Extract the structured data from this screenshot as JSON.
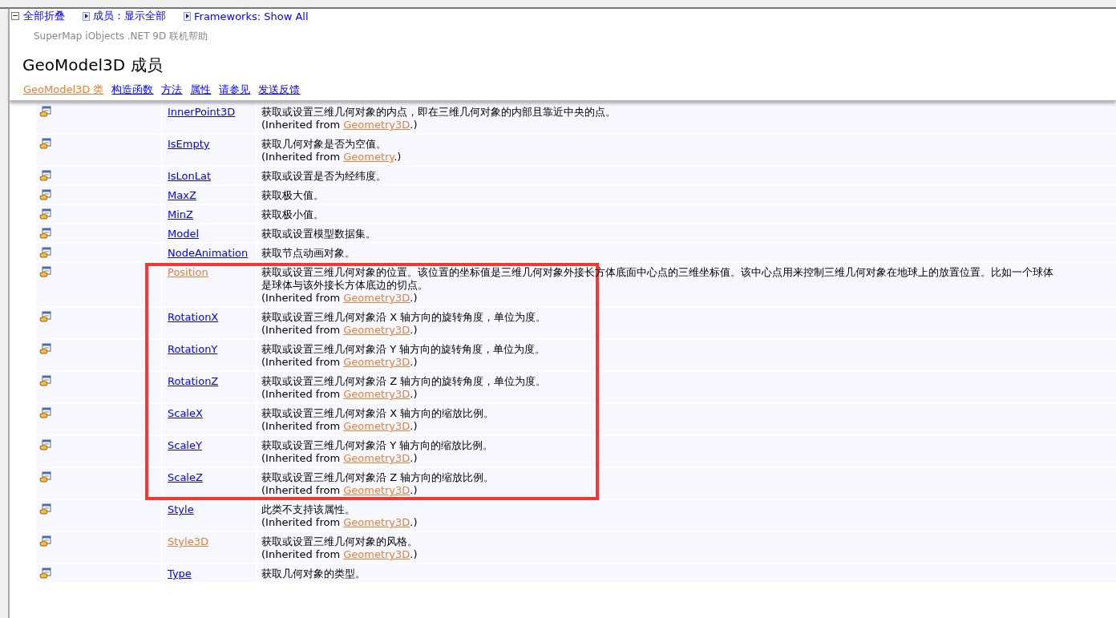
{
  "toolbar": {
    "collapse_all": "全部折叠",
    "members_filter": "成员：显示全部",
    "frameworks_filter": "Frameworks: Show All"
  },
  "header": {
    "subtitle": "SuperMap iObjects .NET 9D 联机帮助",
    "title": "GeoModel3D 成员",
    "nav": [
      {
        "label": "GeoModel3D 类",
        "visited": true
      },
      {
        "label": "构造函数",
        "visited": false
      },
      {
        "label": "方法",
        "visited": false
      },
      {
        "label": "属性",
        "visited": false
      },
      {
        "label": "请参见",
        "visited": false
      },
      {
        "label": "发送反馈",
        "visited": false
      }
    ]
  },
  "members": [
    {
      "name": "InnerPoint3D",
      "visited": false,
      "highlighted": false,
      "lines": [
        "获取或设置三维几何对象的内点，即在三维几何对象的内部且靠近中央的点。"
      ],
      "inherited": {
        "prefix": "(Inherited from ",
        "link": "Geometry3D",
        "suffix": ".)"
      }
    },
    {
      "name": "IsEmpty",
      "visited": false,
      "highlighted": false,
      "lines": [
        "获取几何对象是否为空值。"
      ],
      "inherited": {
        "prefix": "(Inherited from ",
        "link": "Geometry",
        "suffix": ".)"
      }
    },
    {
      "name": "IsLonLat",
      "visited": false,
      "highlighted": false,
      "lines": [
        "获取或设置是否为经纬度。"
      ]
    },
    {
      "name": "MaxZ",
      "visited": false,
      "highlighted": false,
      "lines": [
        "获取极大值。"
      ]
    },
    {
      "name": "MinZ",
      "visited": false,
      "highlighted": false,
      "lines": [
        "获取极小值。"
      ]
    },
    {
      "name": "Model",
      "visited": false,
      "highlighted": false,
      "lines": [
        "获取或设置模型数据集。"
      ]
    },
    {
      "name": "NodeAnimation",
      "visited": false,
      "highlighted": false,
      "lines": [
        "获取节点动画对象。"
      ]
    },
    {
      "name": "Position",
      "visited": true,
      "highlighted": true,
      "lines": [
        "获取或设置三维几何对象的位置。该位置的坐标值是三维几何对象外接长方体底面中心点的三维坐标值。该中心点用来控制三维几何对象在地球上的放置位置。比如一个球体",
        "是球体与该外接长方体底边的切点。"
      ],
      "inherited": {
        "prefix": "(Inherited from ",
        "link": "Geometry3D",
        "suffix": ".)"
      }
    },
    {
      "name": "RotationX",
      "visited": false,
      "highlighted": true,
      "lines": [
        "获取或设置三维几何对象沿 X 轴方向的旋转角度，单位为度。"
      ],
      "inherited": {
        "prefix": "(Inherited from ",
        "link": "Geometry3D",
        "suffix": ".)"
      }
    },
    {
      "name": "RotationY",
      "visited": false,
      "highlighted": true,
      "lines": [
        "获取或设置三维几何对象沿 Y 轴方向的旋转角度，单位为度。"
      ],
      "inherited": {
        "prefix": "(Inherited from ",
        "link": "Geometry3D",
        "suffix": ".)"
      }
    },
    {
      "name": "RotationZ",
      "visited": false,
      "highlighted": true,
      "lines": [
        "获取或设置三维几何对象沿 Z 轴方向的旋转角度，单位为度。"
      ],
      "inherited": {
        "prefix": "(Inherited from ",
        "link": "Geometry3D",
        "suffix": ".)"
      }
    },
    {
      "name": "ScaleX",
      "visited": false,
      "highlighted": true,
      "lines": [
        "获取或设置三维几何对象沿 X 轴方向的缩放比例。"
      ],
      "inherited": {
        "prefix": "(Inherited from ",
        "link": "Geometry3D",
        "suffix": ".)"
      }
    },
    {
      "name": "ScaleY",
      "visited": false,
      "highlighted": true,
      "lines": [
        "获取或设置三维几何对象沿 Y 轴方向的缩放比例。"
      ],
      "inherited": {
        "prefix": "(Inherited from ",
        "link": "Geometry3D",
        "suffix": ".)"
      }
    },
    {
      "name": "ScaleZ",
      "visited": false,
      "highlighted": true,
      "lines": [
        "获取或设置三维几何对象沿 Z 轴方向的缩放比例。"
      ],
      "inherited": {
        "prefix": "(Inherited from ",
        "link": "Geometry3D",
        "suffix": ".)"
      }
    },
    {
      "name": "Style",
      "visited": false,
      "highlighted": false,
      "lines": [
        "此类不支持该属性。"
      ],
      "inherited": {
        "prefix": "(Inherited from ",
        "link": "Geometry3D",
        "suffix": ".)"
      }
    },
    {
      "name": "Style3D",
      "visited": true,
      "highlighted": false,
      "lines": [
        "获取或设置三维几何对象的风格。"
      ],
      "inherited": {
        "prefix": "(Inherited from ",
        "link": "Geometry3D",
        "suffix": ".)"
      }
    },
    {
      "name": "Type",
      "visited": false,
      "highlighted": false,
      "lines": [
        "获取几何对象的类型。"
      ]
    }
  ]
}
